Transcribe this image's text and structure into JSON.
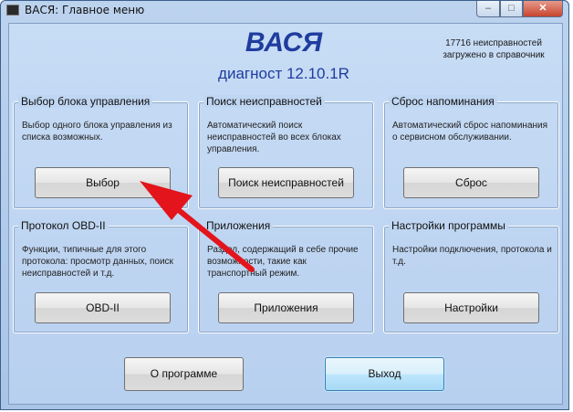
{
  "window": {
    "title": "ВАСЯ:  Главное меню"
  },
  "header": {
    "app_name": "ВАСЯ",
    "subtitle": "диагност 12.10.1R",
    "faults_info_line1": "17716 неисправностей",
    "faults_info_line2": "загружено в справочник"
  },
  "groups": [
    {
      "title": "Выбор блока управления",
      "description": "Выбор одного блока управления из списка возможных.",
      "button": "Выбор"
    },
    {
      "title": "Поиск неисправностей",
      "description": "Автоматический поиск неисправностей во всех блоках управления.",
      "button": "Поиск неисправностей"
    },
    {
      "title": "Сброс напоминания",
      "description": "Автоматический сброс напоминания о сервисном обслуживании.",
      "button": "Сброс"
    },
    {
      "title": "Протокол OBD-II",
      "description": "Функции, типичные для этого протокола: просмотр данных, поиск неисправностей и т.д.",
      "button": "OBD-II"
    },
    {
      "title": "Приложения",
      "description": "Раздел, содержащий в себе прочие возможности, такие как транспортный режим.",
      "button": "Приложения"
    },
    {
      "title": "Настройки программы",
      "description": "Настройки подключения, протокола и т.д.",
      "button": "Настройки"
    }
  ],
  "footer": {
    "about_button": "О программе",
    "exit_button": "Выход"
  },
  "colors": {
    "accent": "#1f3c9e",
    "arrow": "#e3141b"
  },
  "icons": {
    "annotation": "arrow-icon"
  }
}
